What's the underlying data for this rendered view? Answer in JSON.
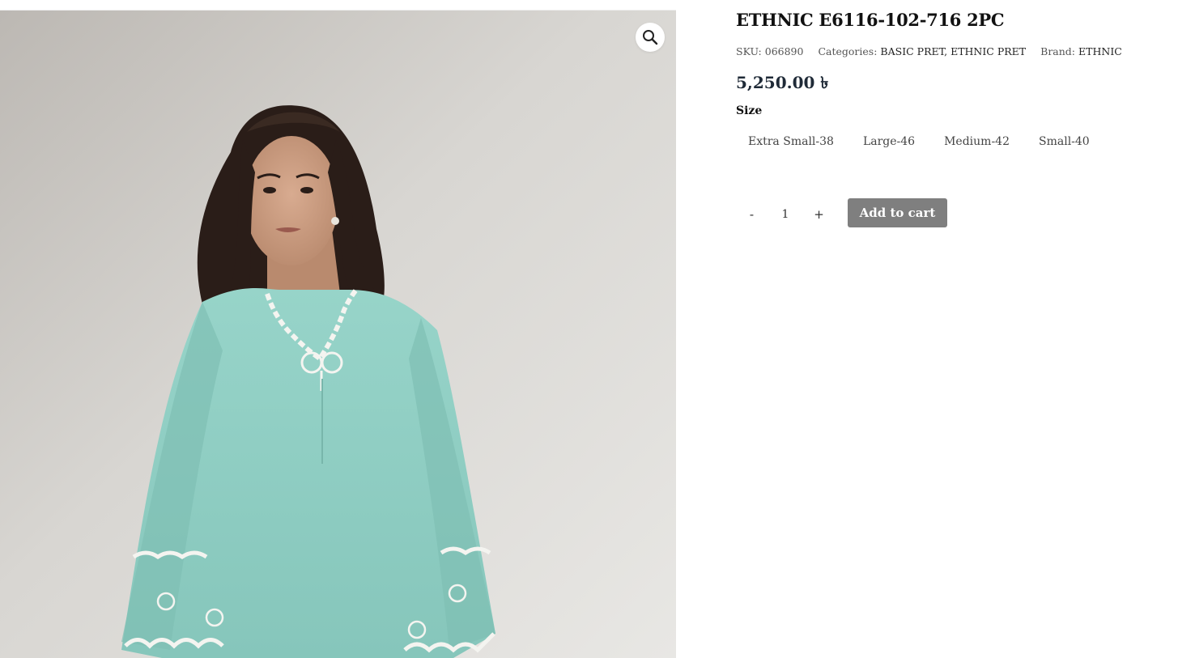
{
  "product": {
    "title": "ETHNIC E6116-102-716 2PC",
    "sku_label": "SKU:",
    "sku": "066890",
    "categories_label": "Categories:",
    "categories": "BASIC PRET, ETHNIC PRET",
    "brand_label": "Brand:",
    "brand": "ETHNIC",
    "price": "5,250.00 ৳"
  },
  "size": {
    "label": "Size",
    "options": [
      "Extra Small-38",
      "Large-46",
      "Medium-42",
      "Small-40"
    ]
  },
  "cart": {
    "minus_label": "-",
    "quantity": "1",
    "plus_label": "+",
    "add_label": "Add to cart"
  },
  "gallery": {
    "zoom_icon": "magnifier-icon",
    "colors": {
      "backdrop": "#d9d7d3",
      "garment": "#8fcfc4",
      "hair": "#2a1d18",
      "skin": "#c99a7e",
      "embroidery": "#f4f4f0"
    }
  },
  "colors": {
    "button": "#7f7f7f",
    "title": "#111111",
    "price": "#1f2a37"
  }
}
